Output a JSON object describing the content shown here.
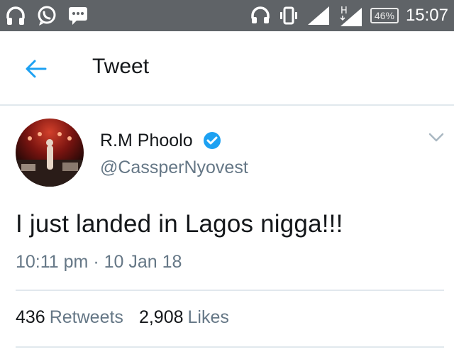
{
  "status_bar": {
    "left_icons": [
      "headphones-icon",
      "whatsapp-icon",
      "message-icon"
    ],
    "right_icons": [
      "headset-icon",
      "vibrate-icon",
      "signal-icon",
      "hspa-signal-icon"
    ],
    "battery_text": "46%",
    "time": "15:07"
  },
  "header": {
    "back_icon": "back-arrow-icon",
    "title": "Tweet"
  },
  "tweet": {
    "display_name": "R.M Phoolo",
    "handle": "@CassperNyovest",
    "verified": true,
    "text": "I just landed in Lagos nigga!!!",
    "timestamp": "10:11 pm · 10 Jan 18",
    "retweets_count": "436",
    "retweets_label": "Retweets",
    "likes_count": "2,908",
    "likes_label": "Likes"
  },
  "colors": {
    "status_bar_bg": "#5f6367",
    "accent": "#1da1f2",
    "secondary_text": "#657786",
    "primary_text": "#14171a",
    "divider": "#e1e8ed"
  }
}
